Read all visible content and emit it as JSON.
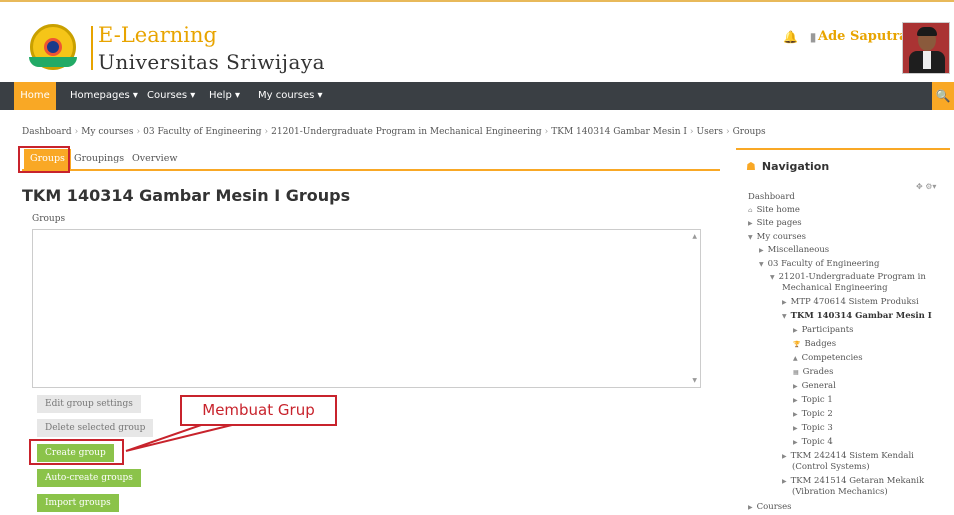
{
  "header": {
    "brand_line1": "E-Learning",
    "brand_line2": "Universitas Sriwijaya",
    "user_name": "Ade Saputra",
    "user_caret": "▾",
    "bell_glyph": "🔔",
    "message_glyph": "▮"
  },
  "navbar": {
    "home": "Home",
    "items": [
      "Homepages ▾",
      "Courses ▾",
      "Help ▾",
      "My courses ▾"
    ],
    "search_glyph": "🔍"
  },
  "breadcrumb": [
    "Dashboard",
    "My courses",
    "03 Faculty of Engineering",
    "21201-Undergraduate Program in Mechanical Engineering",
    "TKM 140314 Gambar Mesin I",
    "Users",
    "Groups"
  ],
  "tabs": {
    "groups": "Groups",
    "groupings": "Groupings",
    "overview": "Overview"
  },
  "main": {
    "title": "TKM 140314 Gambar Mesin I Groups",
    "groups_label": "Groups"
  },
  "buttons": {
    "edit_group_settings": "Edit group settings",
    "delete_selected_group": "Delete selected group",
    "create_group": "Create group",
    "auto_create_groups": "Auto-create groups",
    "import_groups": "Import groups"
  },
  "annotation": {
    "callout": "Membuat Grup"
  },
  "navigation": {
    "title": "Navigation",
    "controls": "✥ ⚙▾",
    "items": {
      "dashboard": "Dashboard",
      "site_home": "Site home",
      "site_pages": "Site pages",
      "my_courses": "My courses",
      "miscellaneous": "Miscellaneous",
      "faculty": "03 Faculty of Engineering",
      "program_line1": "21201-Undergraduate Program in",
      "program_line2": "Mechanical Engineering",
      "mtp": "MTP 470614 Sistem Produksi",
      "tkm_current": "TKM 140314 Gambar Mesin I",
      "participants": "Participants",
      "badges": "Badges",
      "competencies": "Competencies",
      "grades": "Grades",
      "general": "General",
      "topic1": "Topic 1",
      "topic2": "Topic 2",
      "topic3": "Topic 3",
      "topic4": "Topic 4",
      "tkm242414_l1": "TKM 242414 Sistem Kendali",
      "tkm242414_l2": "(Control Systems)",
      "tkm241514_l1": "TKM 241514 Getaran Mekanik",
      "tkm241514_l2": "(Vibration Mechanics)",
      "courses": "Courses"
    }
  },
  "colors": {
    "accent": "#f9a825",
    "navbar": "#3a3f44",
    "green": "#8bc34a",
    "highlight": "#c8232c"
  }
}
